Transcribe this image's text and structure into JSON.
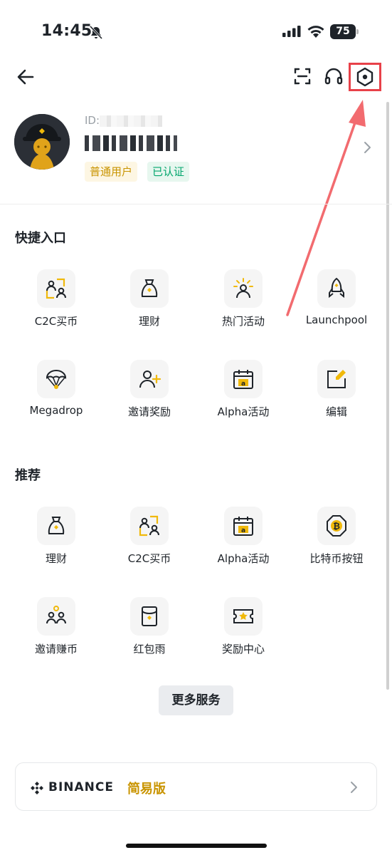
{
  "status_bar": {
    "time": "14:45",
    "battery": "75"
  },
  "profile": {
    "id_label": "ID:8",
    "user_name": "",
    "badges": {
      "regular": "普通用户",
      "verified": "已认证"
    }
  },
  "quick_access": {
    "title": "快捷入口",
    "items": [
      {
        "label": "C2C买币",
        "icon": "c2c-icon"
      },
      {
        "label": "理财",
        "icon": "earn-bag-icon"
      },
      {
        "label": "热门活动",
        "icon": "hot-activity-icon"
      },
      {
        "label": "Launchpool",
        "icon": "rocket-icon"
      },
      {
        "label": "Megadrop",
        "icon": "parachute-icon"
      },
      {
        "label": "邀请奖励",
        "icon": "invite-user-icon"
      },
      {
        "label": "Alpha活动",
        "icon": "alpha-calendar-icon"
      },
      {
        "label": "编辑",
        "icon": "edit-icon"
      }
    ]
  },
  "recommended": {
    "title": "推荐",
    "items": [
      {
        "label": "理财",
        "icon": "earn-bag-icon"
      },
      {
        "label": "C2C买币",
        "icon": "c2c-icon"
      },
      {
        "label": "Alpha活动",
        "icon": "alpha-calendar-icon"
      },
      {
        "label": "比特币按钮",
        "icon": "bitcoin-button-icon"
      },
      {
        "label": "邀请赚币",
        "icon": "invite-earn-icon"
      },
      {
        "label": "红包雨",
        "icon": "red-packet-icon"
      },
      {
        "label": "奖励中心",
        "icon": "reward-ticket-icon"
      }
    ]
  },
  "more_services": "更多服务",
  "lite": {
    "brand": "BINANCE",
    "mode": "简易版"
  },
  "colors": {
    "accent": "#F0B90B",
    "text": "#1E2329",
    "highlight": "#E84149",
    "verified": "#03A66D"
  }
}
